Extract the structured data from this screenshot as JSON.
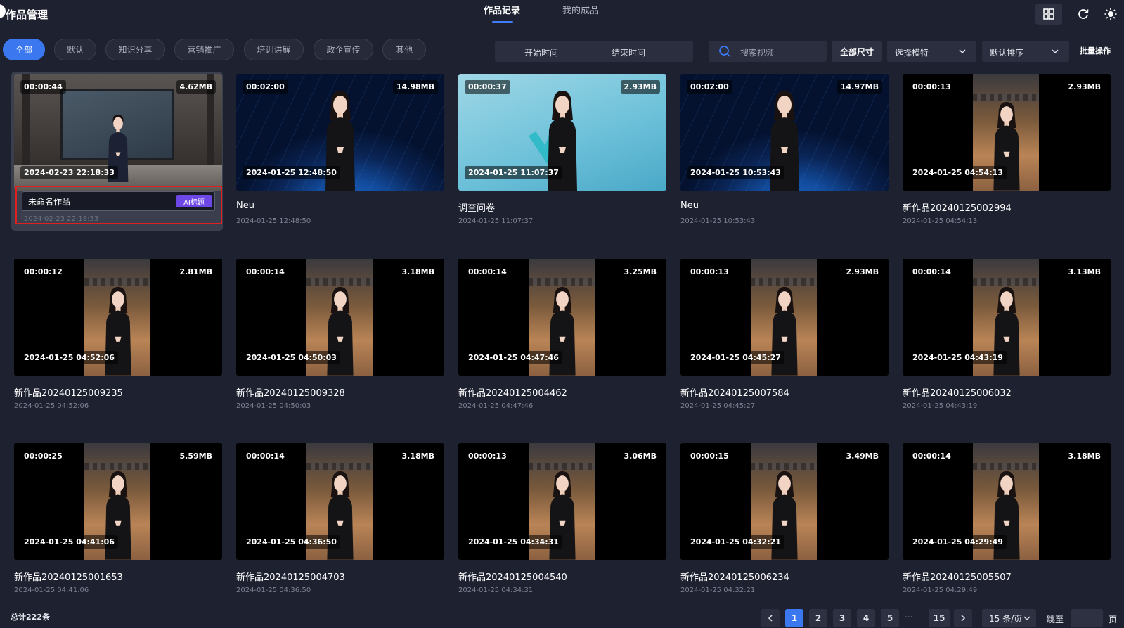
{
  "app": {
    "title": "作品管理"
  },
  "header": {
    "tabs": [
      {
        "label": "作品记录",
        "active": true
      },
      {
        "label": "我的成品",
        "active": false
      }
    ],
    "icons": [
      "grid-view-icon",
      "refresh-icon",
      "theme-sun-icon"
    ]
  },
  "filters": {
    "categories": [
      {
        "label": "全部",
        "active": true
      },
      {
        "label": "默认",
        "active": false
      },
      {
        "label": "知识分享",
        "active": false
      },
      {
        "label": "营销推广",
        "active": false
      },
      {
        "label": "培训讲解",
        "active": false
      },
      {
        "label": "政企宣传",
        "active": false
      },
      {
        "label": "其他",
        "active": false
      }
    ],
    "start_time": "开始时间",
    "end_time": "结束时间",
    "search_placeholder": "搜索视频",
    "size_button": "全部尺寸",
    "model_select": "选择模特",
    "sort_select": "默认排序",
    "batch": "批量操作"
  },
  "works": [
    {
      "duration": "00:00:44",
      "size": "4.62MB",
      "timestamp": "2024-02-23 22:18:33",
      "title": "未命名作品",
      "date": "2024-02-23 22:18:33",
      "bg": "studio",
      "ai_label": "AI标题"
    },
    {
      "duration": "00:02:00",
      "size": "14.98MB",
      "timestamp": "2024-01-25 12:48:50",
      "title": "Neu",
      "date": "2024-01-25 12:48:50",
      "bg": "earth"
    },
    {
      "duration": "00:00:37",
      "size": "2.93MB",
      "timestamp": "2024-01-25 11:07:37",
      "title": "调查问卷",
      "date": "2024-01-25 11:07:37",
      "bg": "survey"
    },
    {
      "duration": "00:02:00",
      "size": "14.97MB",
      "timestamp": "2024-01-25 10:53:43",
      "title": "Neu",
      "date": "2024-01-25 10:53:43",
      "bg": "earth"
    },
    {
      "duration": "00:00:13",
      "size": "2.93MB",
      "timestamp": "2024-01-25 04:54:13",
      "title": "新作品20240125002994",
      "date": "2024-01-25 04:54:13",
      "bg": "hall"
    },
    {
      "duration": "00:00:12",
      "size": "2.81MB",
      "timestamp": "2024-01-25 04:52:06",
      "title": "新作品20240125009235",
      "date": "2024-01-25 04:52:06",
      "bg": "hall"
    },
    {
      "duration": "00:00:14",
      "size": "3.18MB",
      "timestamp": "2024-01-25 04:50:03",
      "title": "新作品20240125009328",
      "date": "2024-01-25 04:50:03",
      "bg": "hall"
    },
    {
      "duration": "00:00:14",
      "size": "3.25MB",
      "timestamp": "2024-01-25 04:47:46",
      "title": "新作品20240125004462",
      "date": "2024-01-25 04:47:46",
      "bg": "hall"
    },
    {
      "duration": "00:00:13",
      "size": "2.93MB",
      "timestamp": "2024-01-25 04:45:27",
      "title": "新作品20240125007584",
      "date": "2024-01-25 04:45:27",
      "bg": "hall"
    },
    {
      "duration": "00:00:14",
      "size": "3.13MB",
      "timestamp": "2024-01-25 04:43:19",
      "title": "新作品20240125006032",
      "date": "2024-01-25 04:43:19",
      "bg": "hall"
    },
    {
      "duration": "00:00:25",
      "size": "5.59MB",
      "timestamp": "2024-01-25 04:41:06",
      "title": "新作品20240125001653",
      "date": "2024-01-25 04:41:06",
      "bg": "hall"
    },
    {
      "duration": "00:00:14",
      "size": "3.18MB",
      "timestamp": "2024-01-25 04:36:50",
      "title": "新作品20240125004703",
      "date": "2024-01-25 04:36:50",
      "bg": "hall"
    },
    {
      "duration": "00:00:13",
      "size": "3.06MB",
      "timestamp": "2024-01-25 04:34:31",
      "title": "新作品20240125004540",
      "date": "2024-01-25 04:34:31",
      "bg": "hall"
    },
    {
      "duration": "00:00:15",
      "size": "3.49MB",
      "timestamp": "2024-01-25 04:32:21",
      "title": "新作品20240125006234",
      "date": "2024-01-25 04:32:21",
      "bg": "hall"
    },
    {
      "duration": "00:00:14",
      "size": "3.18MB",
      "timestamp": "2024-01-25 04:29:49",
      "title": "新作品20240125005507",
      "date": "2024-01-25 04:29:49",
      "bg": "hall"
    }
  ],
  "pagination": {
    "total": "总计222条",
    "prev": "<",
    "next": ">",
    "pages": [
      "1",
      "2",
      "3",
      "4",
      "5"
    ],
    "ellipsis": "···",
    "last_page": "15",
    "current": "1",
    "per_page": "15 条/页",
    "jump_label": "跳至",
    "page_unit": "页"
  },
  "colors": {
    "accent": "#3b78f0",
    "ai_button": "#6e48e6",
    "highlight_border": "#e21f1f",
    "background": "#1e2130"
  }
}
